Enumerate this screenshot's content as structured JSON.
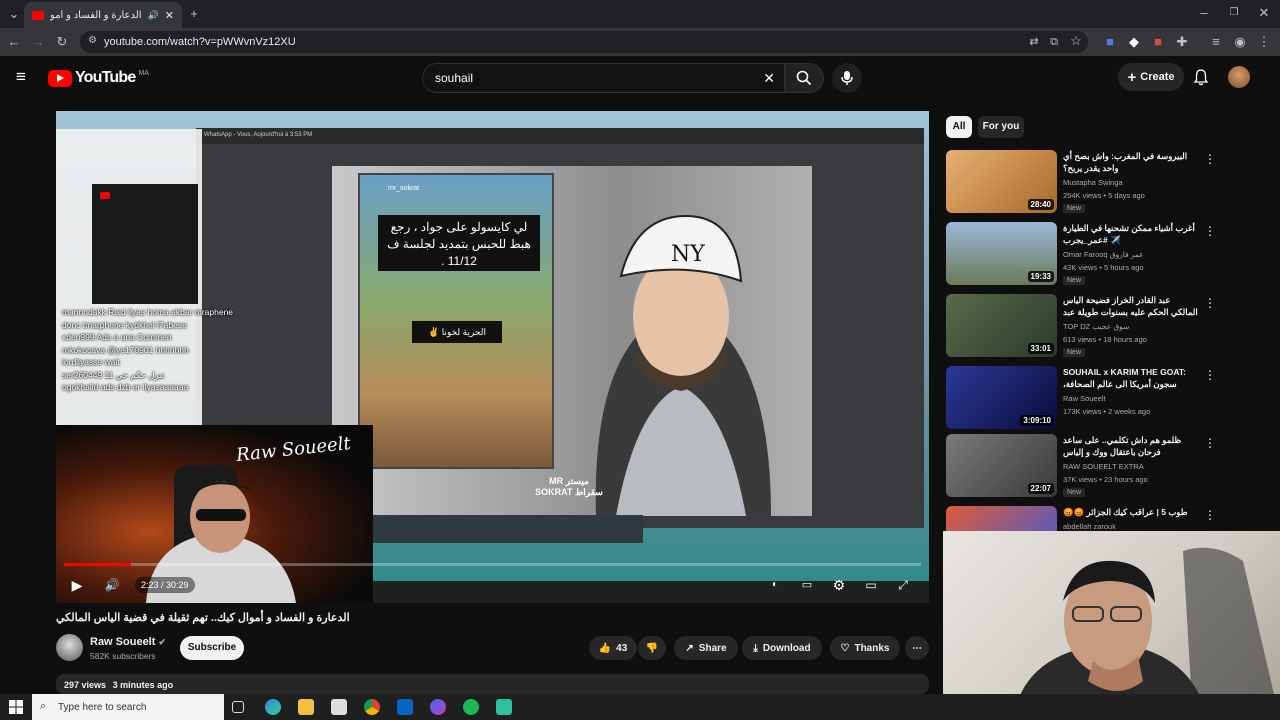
{
  "browser": {
    "tab_title": "الدعارة و الفساد و أموال كيك..",
    "url": "youtube.com/watch?v=pWWvnVz12XU"
  },
  "header": {
    "logo_text": "YouTube",
    "logo_country": "MA",
    "search_value": "souhail",
    "create_label": "Create"
  },
  "player": {
    "time_current": "2:23",
    "time_total": "30:29",
    "time_display": "2:23 / 30:29",
    "progress_fraction": 0.078,
    "story_user": "mr_sokrat",
    "story_text": "لي كايسولو على جواد ، رجع هبط للحبس بتمديد لجلسة ف 11/12 .",
    "story_tag": "الحرية لخونا ✌",
    "caption_mr": "MR ميستر\nSOKRAT سقراط",
    "stream_logo": "Raw Soueelt",
    "chat": [
      "mannndakk  Raid ilyas homa akbar mraphene",
      "donc tmarphene kydkhel l7abese",
      "xden999  Ads a ana Commen",
      "mkokocava @ye170901 hhhhhhh",
      "lordilyasse  wait",
      "ser260449  11 تنزل حكم جي",
      "ogokhalid  ads dzb er ilyasaaaaaa"
    ]
  },
  "video": {
    "title": "الدعارة و الفساد و أموال كيك.. تهم ثقيلة في قضية الياس المالكي",
    "channel": "Raw Soueelt",
    "subscribers": "582K subscribers",
    "subscribe_label": "Subscribe",
    "likes": "43",
    "share_label": "Share",
    "download_label": "Download",
    "thanks_label": "Thanks",
    "views": "297 views",
    "age": "3 minutes ago"
  },
  "sidebar": {
    "chips": [
      "All",
      "For you"
    ],
    "recs": [
      {
        "title": "البيروسة في المغرب: واش بصح أي واحد يقدر يربح؟",
        "channel": "Mustapha Swinga",
        "meta": "254K views • 5 days ago",
        "new": "New",
        "duration": "28:40",
        "color": "#c98a4a"
      },
      {
        "title": "أغرب أشياء ممكن تشحنها في الطيارة ✈️ #عمر_يجرب",
        "channel": "Omar Farooq عمر فاروق",
        "meta": "43K views • 5 hours ago",
        "new": "New",
        "duration": "19:33",
        "color": "#8aa0b8"
      },
      {
        "title": "عبد القادر الخراز فضيحة الياس المالكي الحكم عليه بسنوات طويلة عبد القادر الخراز يحكي",
        "channel": "TOP DZ سوق عجيب",
        "meta": "613 views • 18 hours ago",
        "new": "New",
        "duration": "33:01",
        "color": "#7a8a6a"
      },
      {
        "title": "SOUHAIL x KARIM THE GOAT: سجون أمريكا الى عالم الصحافة، التطليع و...",
        "channel": "Raw Soueelt",
        "meta": "173K views • 2 weeks ago",
        "new": "",
        "duration": "3:09:10",
        "color": "#3a4a8a"
      },
      {
        "title": "ظلمو هم داش تكلمي.. على ساعد فرحان باعتقال ووك و إلياس",
        "channel": "RAW SOUEELT EXTRA",
        "meta": "37K views • 23 hours ago",
        "new": "New",
        "duration": "22:07",
        "color": "#6a6a6a"
      },
      {
        "title": "طوب 5 | عراقب كيك الجزائر 😡😡",
        "channel": "abdellah zarouk",
        "meta": "",
        "new": "",
        "duration": "",
        "color": "#c84a3a"
      }
    ]
  },
  "taskbar": {
    "search_placeholder": "Type here to search"
  },
  "colors": {
    "youtube_red": "#ff0000",
    "background": "#0f0f0f",
    "pill": "#272727"
  }
}
